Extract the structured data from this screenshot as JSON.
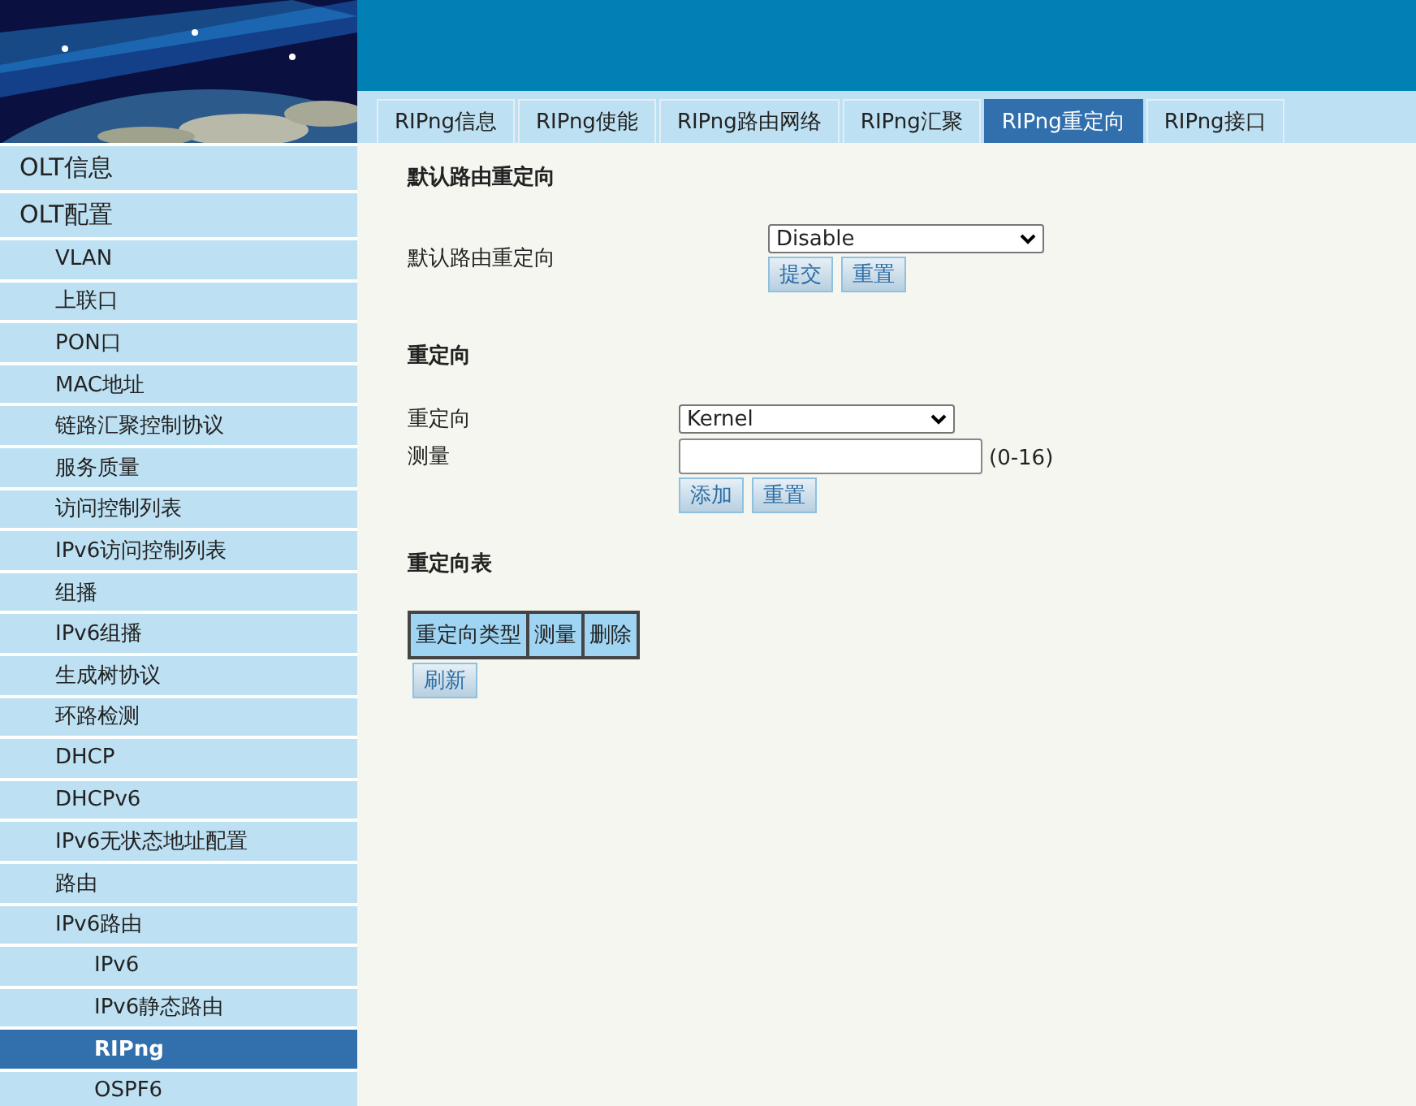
{
  "tabs": [
    {
      "label": "RIPng信息",
      "selected": false
    },
    {
      "label": "RIPng使能",
      "selected": false
    },
    {
      "label": "RIPng路由网络",
      "selected": false
    },
    {
      "label": "RIPng汇聚",
      "selected": false
    },
    {
      "label": "RIPng重定向",
      "selected": true
    },
    {
      "label": "RIPng接口",
      "selected": false
    }
  ],
  "sidebar": {
    "items": [
      {
        "label": "OLT信息",
        "selected": false
      },
      {
        "label": "OLT配置",
        "selected": false,
        "children": [
          {
            "label": "VLAN",
            "selected": false
          },
          {
            "label": "上联口",
            "selected": false
          },
          {
            "label": "PON口",
            "selected": false
          },
          {
            "label": "MAC地址",
            "selected": false
          },
          {
            "label": "链路汇聚控制协议",
            "selected": false
          },
          {
            "label": "服务质量",
            "selected": false
          },
          {
            "label": "访问控制列表",
            "selected": false
          },
          {
            "label": "IPv6访问控制列表",
            "selected": false
          },
          {
            "label": "组播",
            "selected": false
          },
          {
            "label": "IPv6组播",
            "selected": false
          },
          {
            "label": "生成树协议",
            "selected": false
          },
          {
            "label": "环路检测",
            "selected": false
          },
          {
            "label": "DHCP",
            "selected": false
          },
          {
            "label": "DHCPv6",
            "selected": false
          },
          {
            "label": "IPv6无状态地址配置",
            "selected": false
          },
          {
            "label": "路由",
            "selected": false
          },
          {
            "label": "IPv6路由",
            "selected": false,
            "children": [
              {
                "label": "IPv6",
                "selected": false
              },
              {
                "label": "IPv6静态路由",
                "selected": false
              },
              {
                "label": "RIPng",
                "selected": true
              },
              {
                "label": "OSPF6",
                "selected": false
              }
            ]
          }
        ]
      }
    ]
  },
  "default_redirect": {
    "title": "默认路由重定向",
    "label": "默认路由重定向",
    "value": "Disable",
    "buttons": [
      "提交",
      "重置"
    ]
  },
  "redirect": {
    "title": "重定向",
    "type_label": "重定向",
    "type_value": "Kernel",
    "metric_label": "测量",
    "metric_hint": "(0-16)",
    "buttons": [
      "添加",
      "重置"
    ]
  },
  "redirect_table": {
    "title": "重定向表",
    "columns": [
      "重定向类型",
      "测量",
      "删除"
    ],
    "buttons": [
      "刷新"
    ]
  }
}
